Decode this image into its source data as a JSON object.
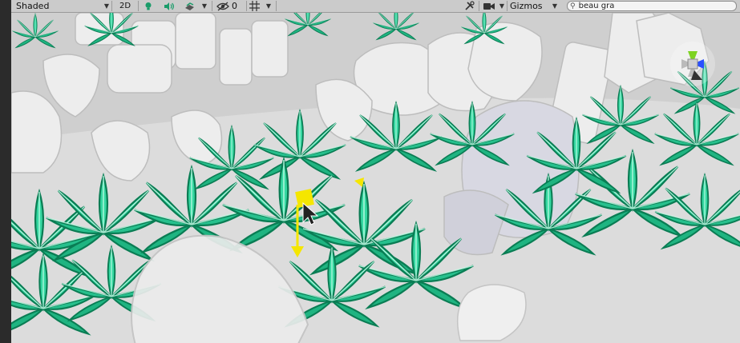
{
  "toolbar": {
    "shading_mode": "Shaded",
    "mode_2d": "2D",
    "hidden_count": "0",
    "gizmos_label": "Gizmos",
    "search_value": "beau gra"
  },
  "colors": {
    "toolbar_bg": "#cbcbcb",
    "grass": "#2fcf9a",
    "grass_dark": "#0b8a5e",
    "rock": "#e8e8e8",
    "selection": "#f5e600"
  },
  "icons": [
    "lightbulb-icon",
    "audio-icon",
    "effects-icon",
    "visibility-icon",
    "grid-icon",
    "tools-icon",
    "camera-icon",
    "search-icon",
    "scene-gizmo-icon",
    "cursor-icon"
  ]
}
